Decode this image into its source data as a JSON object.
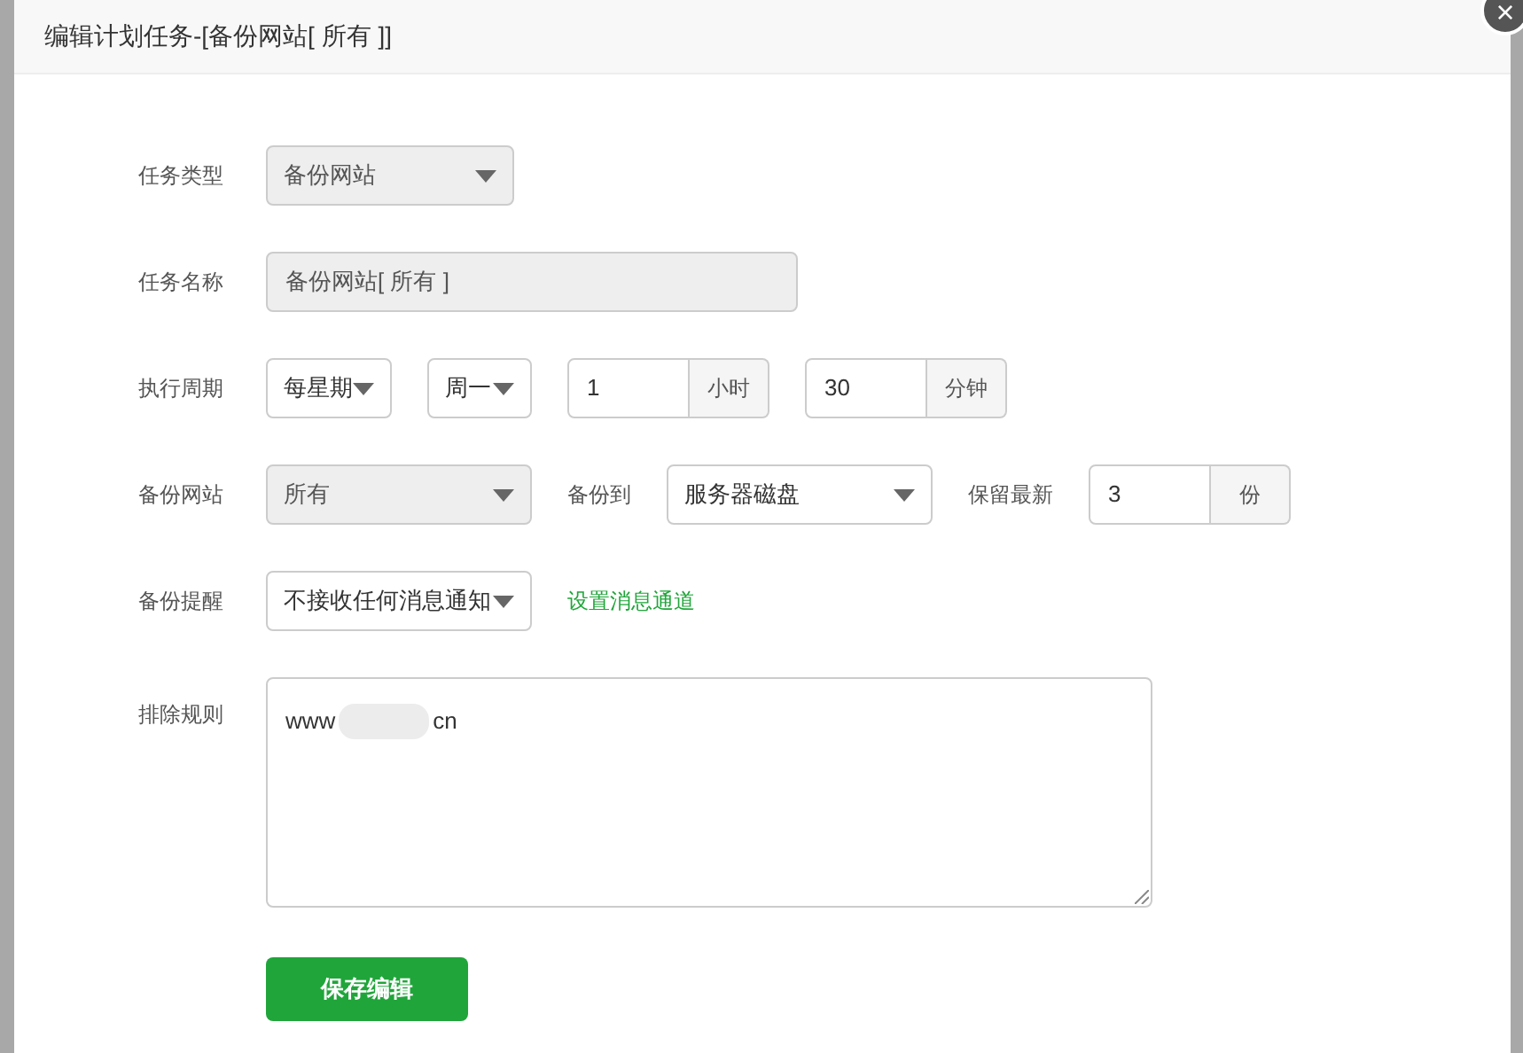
{
  "dialog": {
    "title": "编辑计划任务-[备份网站[ 所有 ]]",
    "close": "×"
  },
  "rows": [
    {
      "label": "任务类型",
      "controls": [
        {
          "kind": "select",
          "value": "备份网站",
          "disabled": true
        }
      ]
    },
    {
      "label": "任务名称",
      "controls": [
        {
          "kind": "input",
          "value": "备份网站[ 所有 ]",
          "disabled": true
        }
      ]
    },
    {
      "label": "执行周期",
      "controls": [
        {
          "kind": "select",
          "value": "每星期",
          "disabled": false
        },
        {
          "kind": "select",
          "value": "周一",
          "disabled": false
        },
        {
          "kind": "addon",
          "value": "1",
          "unit": "小时"
        },
        {
          "kind": "addon",
          "value": "30",
          "unit": "分钟"
        }
      ]
    },
    {
      "label": "备份网站",
      "controls": [
        {
          "kind": "select",
          "value": "所有",
          "disabled": true
        },
        {
          "kind": "label",
          "value": "备份到"
        },
        {
          "kind": "select",
          "value": "服务器磁盘",
          "disabled": false
        },
        {
          "kind": "label",
          "value": "保留最新"
        },
        {
          "kind": "addon",
          "value": "3",
          "unit": "份"
        }
      ]
    },
    {
      "label": "备份提醒",
      "controls": [
        {
          "kind": "select",
          "value": "不接收任何消息通知",
          "disabled": false
        },
        {
          "kind": "link",
          "value": "设置消息通道"
        }
      ]
    }
  ],
  "exclude": {
    "label": "排除规则",
    "value_start": "www",
    "value_end": "cn"
  },
  "save_button": "保存编辑"
}
